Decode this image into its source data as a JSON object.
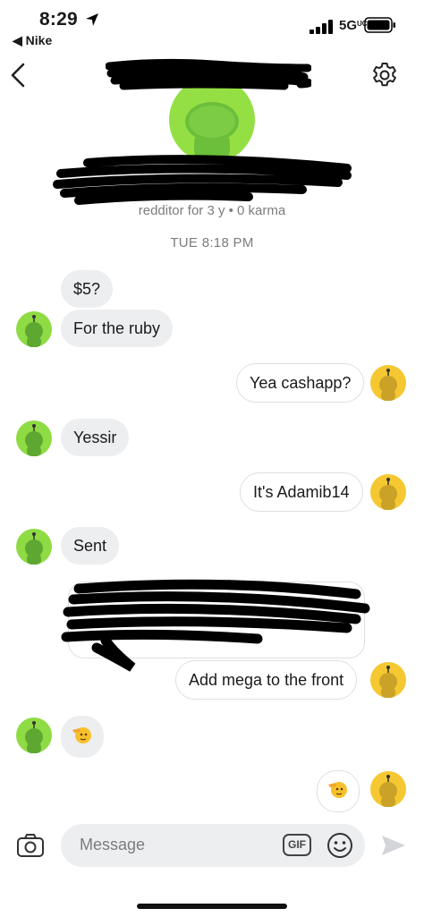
{
  "status_bar": {
    "time": "8:29",
    "back_app": "◀ Nike",
    "network": "5G",
    "network_sub": "UC"
  },
  "profile": {
    "meta": "redditor for 3 y • 0 karma"
  },
  "chat": {
    "date": "TUE 8:18 PM",
    "messages": [
      {
        "from": "them",
        "text": "$5?"
      },
      {
        "from": "them",
        "text": "For the ruby"
      },
      {
        "from": "me",
        "text": "Yea cashapp?"
      },
      {
        "from": "them",
        "text": "Yessir"
      },
      {
        "from": "me",
        "text": "It's Adamib14"
      },
      {
        "from": "them",
        "text": "Sent"
      },
      {
        "from": "me",
        "text": "Add mega to the front"
      },
      {
        "from": "them",
        "text": "🫡"
      },
      {
        "from": "me",
        "text": "🫡"
      }
    ]
  },
  "composer": {
    "placeholder": "Message",
    "gif_label": "GIF"
  },
  "colors": {
    "them_avatar": "#8fdb44",
    "me_avatar": "#f5c832",
    "incoming_bubble": "#edeef0",
    "placeholder": "#7c7c7c"
  }
}
